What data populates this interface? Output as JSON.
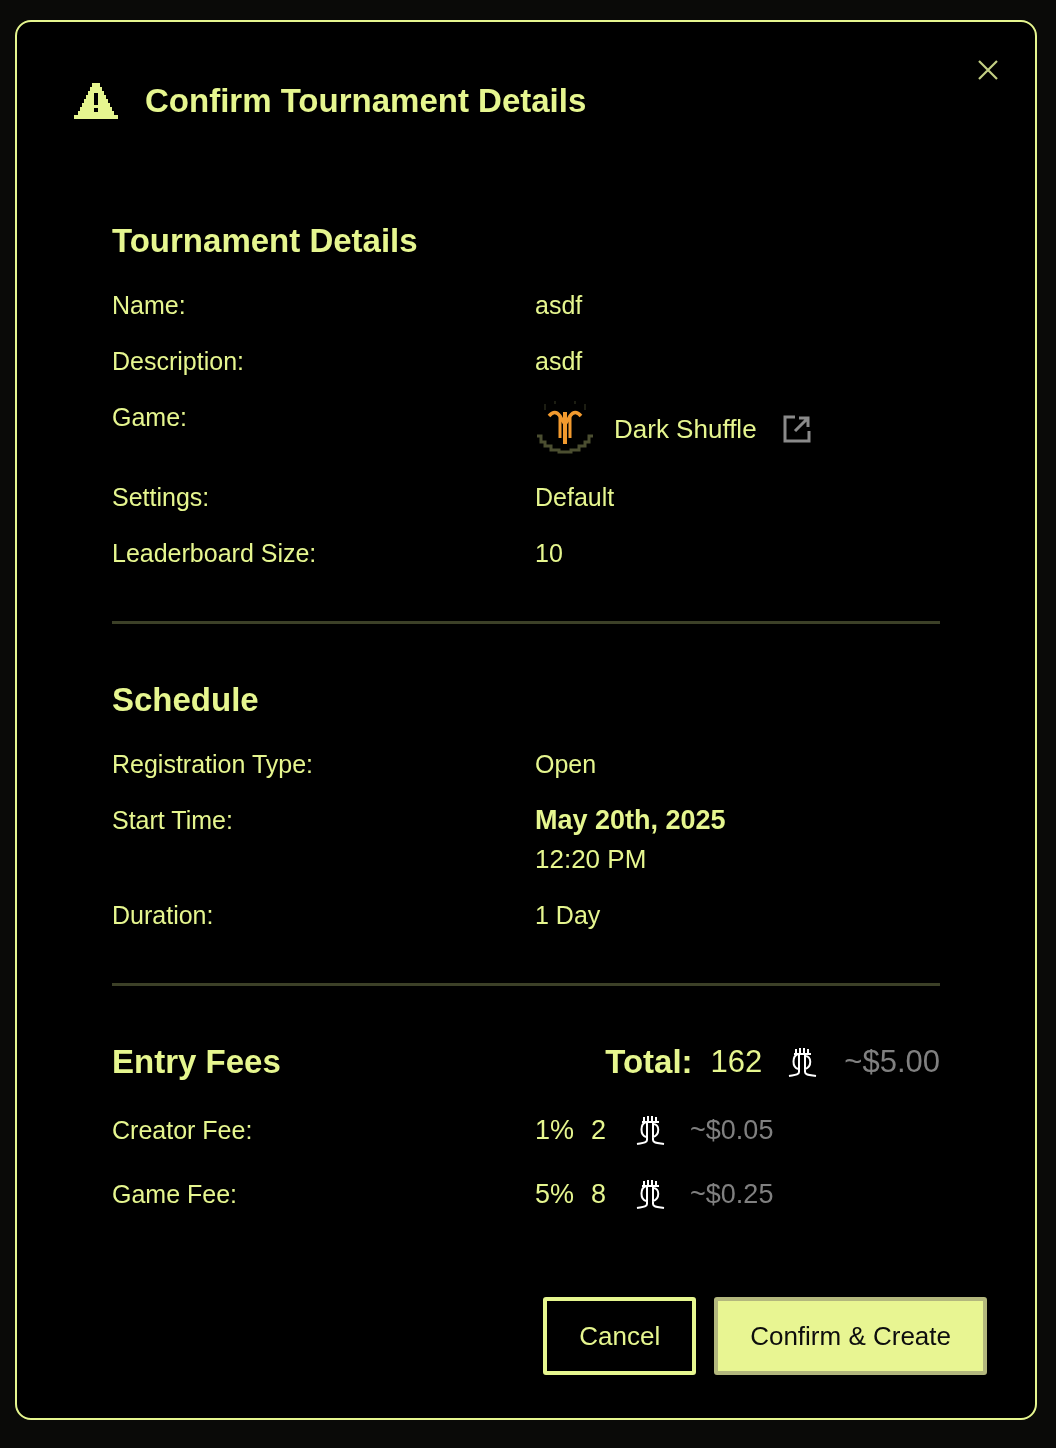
{
  "dialog": {
    "title": "Confirm Tournament Details"
  },
  "sections": [
    {
      "heading": "Tournament Details",
      "rows": [
        {
          "kind": "text",
          "label": "Name:",
          "value": "asdf"
        },
        {
          "kind": "text",
          "label": "Description:",
          "value": "asdf"
        },
        {
          "kind": "game",
          "label": "Game:",
          "value": "Dark Shuffle"
        },
        {
          "kind": "text",
          "label": "Settings:",
          "value": "Default"
        },
        {
          "kind": "text",
          "label": "Leaderboard Size:",
          "value": "10"
        }
      ]
    },
    {
      "heading": "Schedule",
      "rows": [
        {
          "kind": "text",
          "label": "Registration Type:",
          "value": "Open"
        },
        {
          "kind": "datetime",
          "label": "Start Time:",
          "date": "May 20th, 2025",
          "time": "12:20 PM"
        },
        {
          "kind": "text",
          "label": "Duration:",
          "value": "1 Day"
        }
      ]
    },
    {
      "heading": "Entry Fees",
      "total": {
        "label": "Total:",
        "amount": "162",
        "usd": "~$5.00"
      },
      "rows": [
        {
          "kind": "fee",
          "label": "Creator Fee:",
          "percent": "1%",
          "amount": "2",
          "usd": "~$0.05"
        },
        {
          "kind": "fee",
          "label": "Game Fee:",
          "percent": "5%",
          "amount": "8",
          "usd": "~$0.25"
        }
      ]
    }
  ],
  "buttons": [
    {
      "kind": "secondary",
      "label": "Cancel"
    },
    {
      "kind": "primary",
      "label": "Confirm & Create"
    }
  ]
}
